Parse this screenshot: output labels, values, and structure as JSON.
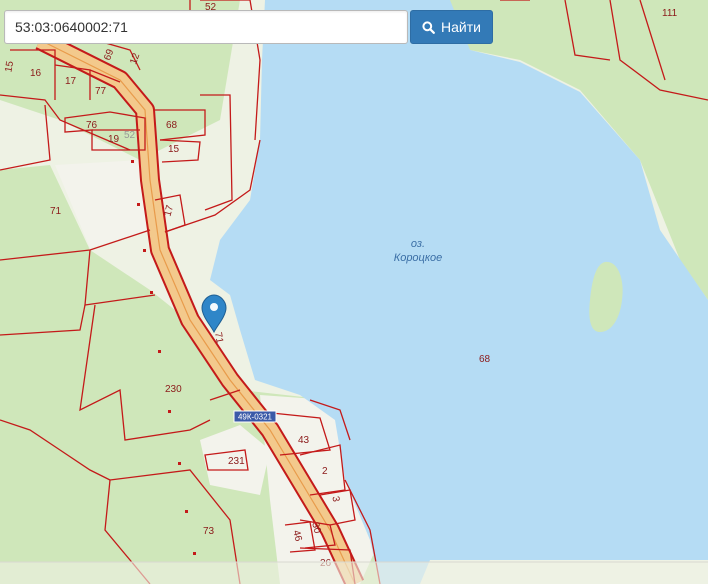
{
  "search": {
    "value": "53:03:0640002:71",
    "button_label": "Найти"
  },
  "lake": {
    "line1": "оз.",
    "line2": "Короцкое"
  },
  "road_number": "49К-0321",
  "parcels": [
    "52",
    "111",
    "15",
    "16",
    "17",
    "77",
    "69",
    "12",
    "76",
    "19",
    "52",
    "68",
    "15",
    "71",
    "17",
    "71",
    "230",
    "231",
    "73",
    "43",
    "2",
    "3",
    "30",
    "46",
    "26",
    "68"
  ],
  "colors": {
    "water": "#b5dcf4",
    "forest": "#cde6b8",
    "clearing": "#f2f2ea",
    "parcel_border": "#c41a1a",
    "road_fill": "#f3c98c",
    "road_border": "#c41a1a",
    "marker": "#2f86c8",
    "button": "#337ab7"
  }
}
